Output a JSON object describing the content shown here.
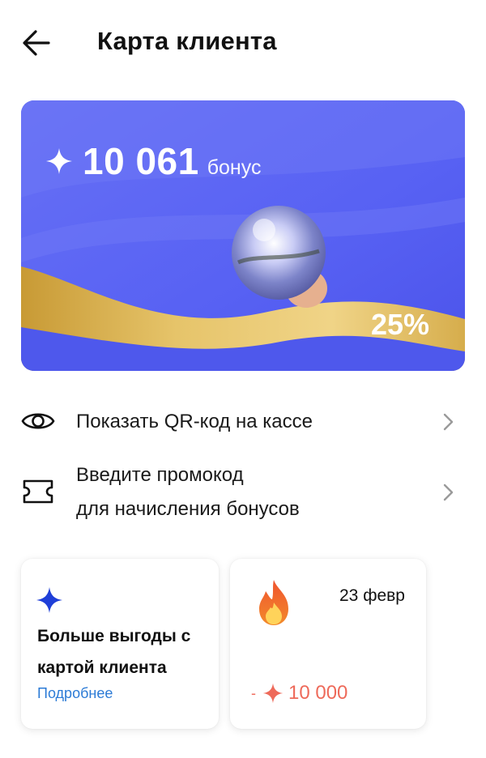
{
  "header": {
    "title": "Карта клиента",
    "back_icon": "arrow-left-icon"
  },
  "card": {
    "bonus_value": "10 061",
    "bonus_unit": "бонус",
    "percent": "25%",
    "colors": {
      "background": "#5a63f2",
      "wave": "#d9b24a",
      "text": "#ffffff"
    }
  },
  "actions": [
    {
      "icon": "eye-icon",
      "label": "Показать QR-код на кассе"
    },
    {
      "icon": "ticket-icon",
      "line1": "Введите промокод",
      "line2": "для начисления бонусов"
    }
  ],
  "tiles": {
    "promo": {
      "title": "Больше выгоды с картой клиента",
      "link": "Подробнее",
      "accent": "#1f3fd8",
      "link_color": "#2c7bd6"
    },
    "history": {
      "date": "23 февр",
      "sign": "-",
      "amount": "10 000",
      "amount_color": "#ee6a5a"
    }
  }
}
